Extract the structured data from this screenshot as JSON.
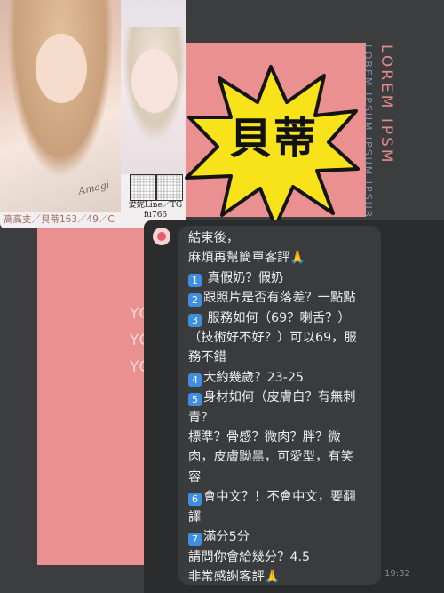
{
  "background": {
    "lorem_vertical": "LOREM IPSM",
    "lorem_vertical_sub": "LOREM IPSUM IPSUM IPSURE",
    "poster_lines": [
      "YO",
      "YO",
      "YO"
    ],
    "colors": {
      "poster": "#eb9090",
      "backdrop": "#3c3d3f"
    }
  },
  "profile_card": {
    "caption": "高高支／貝蒂163／49／C",
    "contact": "愛妮Line／TG\nfu766",
    "signature": "Amagi"
  },
  "name_badge": {
    "text": "貝蒂",
    "color": "#f8e21a"
  },
  "message": {
    "lines": [
      {
        "text": "結束後，"
      },
      {
        "text": "麻煩再幫簡單客評",
        "emoji": "🙏"
      },
      {
        "num": "1",
        "text": " 真假奶？假奶"
      },
      {
        "num": "2",
        "text": "跟照片是否有落差？一點點"
      },
      {
        "num": "3",
        "text": " 服務如何（69？喇舌？）"
      },
      {
        "text": "（技術好不好？）可以69，服"
      },
      {
        "text": "務不錯"
      },
      {
        "num": "4",
        "text": "大約幾歲？23-25"
      },
      {
        "num": "5",
        "text": "身材如何（皮膚白？有無刺"
      },
      {
        "text": "青？"
      },
      {
        "text": "標準？骨感？微肉？胖？微"
      },
      {
        "text": "肉，皮膚黝黑，可愛型，有笑"
      },
      {
        "text": "容"
      },
      {
        "num": "6",
        "text": "會中文？！不會中文，要翻"
      },
      {
        "text": "譯"
      },
      {
        "num": "7",
        "text": "滿分5分"
      },
      {
        "text": "請問你會給幾分？4.5"
      },
      {
        "text": "非常感謝客評",
        "emoji": "🙏"
      }
    ],
    "time": "19:32"
  }
}
